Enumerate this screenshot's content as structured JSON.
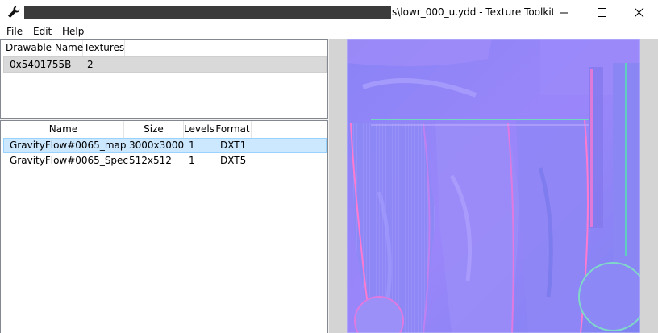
{
  "window": {
    "title": "s\\lowr_000_u.ydd - Texture Toolkit",
    "minimize_icon": "minimize-icon",
    "maximize_icon": "maximize-icon",
    "close_icon": "close-icon",
    "app_icon": "wrench-icon"
  },
  "menu": {
    "file": "File",
    "edit": "Edit",
    "help": "Help"
  },
  "drawables": {
    "columns": [
      "Drawable Name",
      "Textures"
    ],
    "rows": [
      {
        "name": "0x5401755B",
        "textures": "2"
      }
    ]
  },
  "textures": {
    "columns": [
      "Name",
      "Size",
      "Levels",
      "Format"
    ],
    "rows": [
      {
        "name": "GravityFlow#0065_map",
        "size": "3000x3000",
        "levels": "1",
        "format": "DXT1"
      },
      {
        "name": "GravityFlow#0065_Spec",
        "size": "512x512",
        "levels": "1",
        "format": "DXT5"
      }
    ],
    "selected_index": 0
  },
  "colors": {
    "selection": "#cce8ff",
    "normal_map_base": "#8a80f8"
  }
}
